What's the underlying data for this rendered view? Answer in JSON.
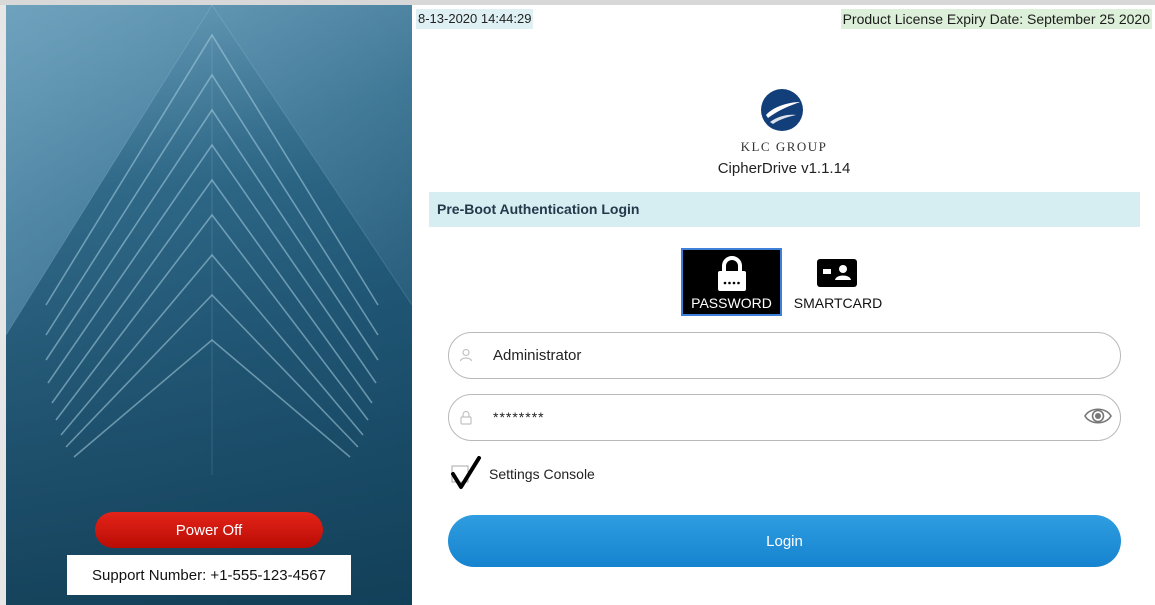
{
  "header": {
    "datetime": "8-13-2020 14:44:29",
    "license": "Product License Expiry Date: September 25 2020"
  },
  "branding": {
    "company": "KLC GROUP",
    "product": "CipherDrive v1.1.14"
  },
  "auth": {
    "title": "Pre-Boot Authentication Login",
    "methods": [
      {
        "label": "PASSWORD",
        "icon": "lock-keypad-icon",
        "selected": true
      },
      {
        "label": "SMARTCARD",
        "icon": "id-card-icon",
        "selected": false
      }
    ],
    "username": {
      "value": "Administrator",
      "icon": "user-icon"
    },
    "password": {
      "value": "********",
      "icon": "lock-icon",
      "toggle_icon": "eye-icon"
    },
    "settings_console": {
      "label": "Settings Console",
      "checked": true
    },
    "login_label": "Login"
  },
  "left_panel": {
    "power_off_label": "Power Off",
    "support_text": "Support Number: +1-555-123-4567"
  },
  "colors": {
    "accent_blue": "#1d8ad6",
    "power_red": "#d0180f",
    "header_band": "#d6eef2",
    "panel_dark": "#1a4f6e"
  }
}
